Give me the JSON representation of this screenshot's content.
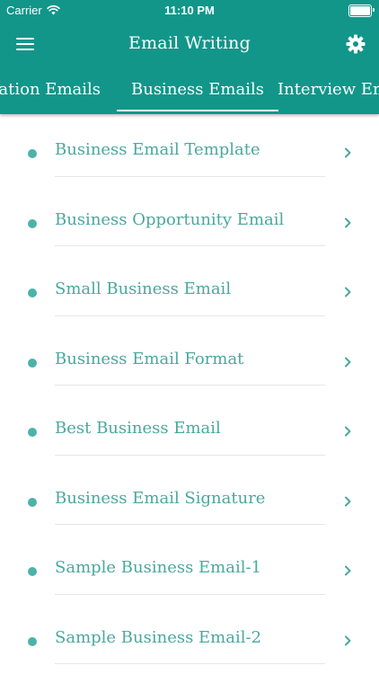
{
  "status_bar": {
    "carrier": "Carrier",
    "time": "11:10 PM"
  },
  "nav": {
    "title": "Email Writing",
    "menu_icon": "hamburger-menu-icon",
    "settings_icon": "gear-icon"
  },
  "tabs": [
    {
      "label": "Application Emails",
      "active": false
    },
    {
      "label": "Business Emails",
      "active": true
    },
    {
      "label": "Interview Emails",
      "active": false
    }
  ],
  "items": [
    {
      "label": "Business Email Template"
    },
    {
      "label": "Business Opportunity Email"
    },
    {
      "label": "Small Business Email"
    },
    {
      "label": "Business Email Format"
    },
    {
      "label": "Best Business Email"
    },
    {
      "label": "Business Email Signature"
    },
    {
      "label": "Sample Business Email-1"
    },
    {
      "label": "Sample Business Email-2"
    }
  ],
  "colors": {
    "header": "#12968a",
    "accent": "#4bb3a7",
    "divider": "#e6e6e6"
  }
}
